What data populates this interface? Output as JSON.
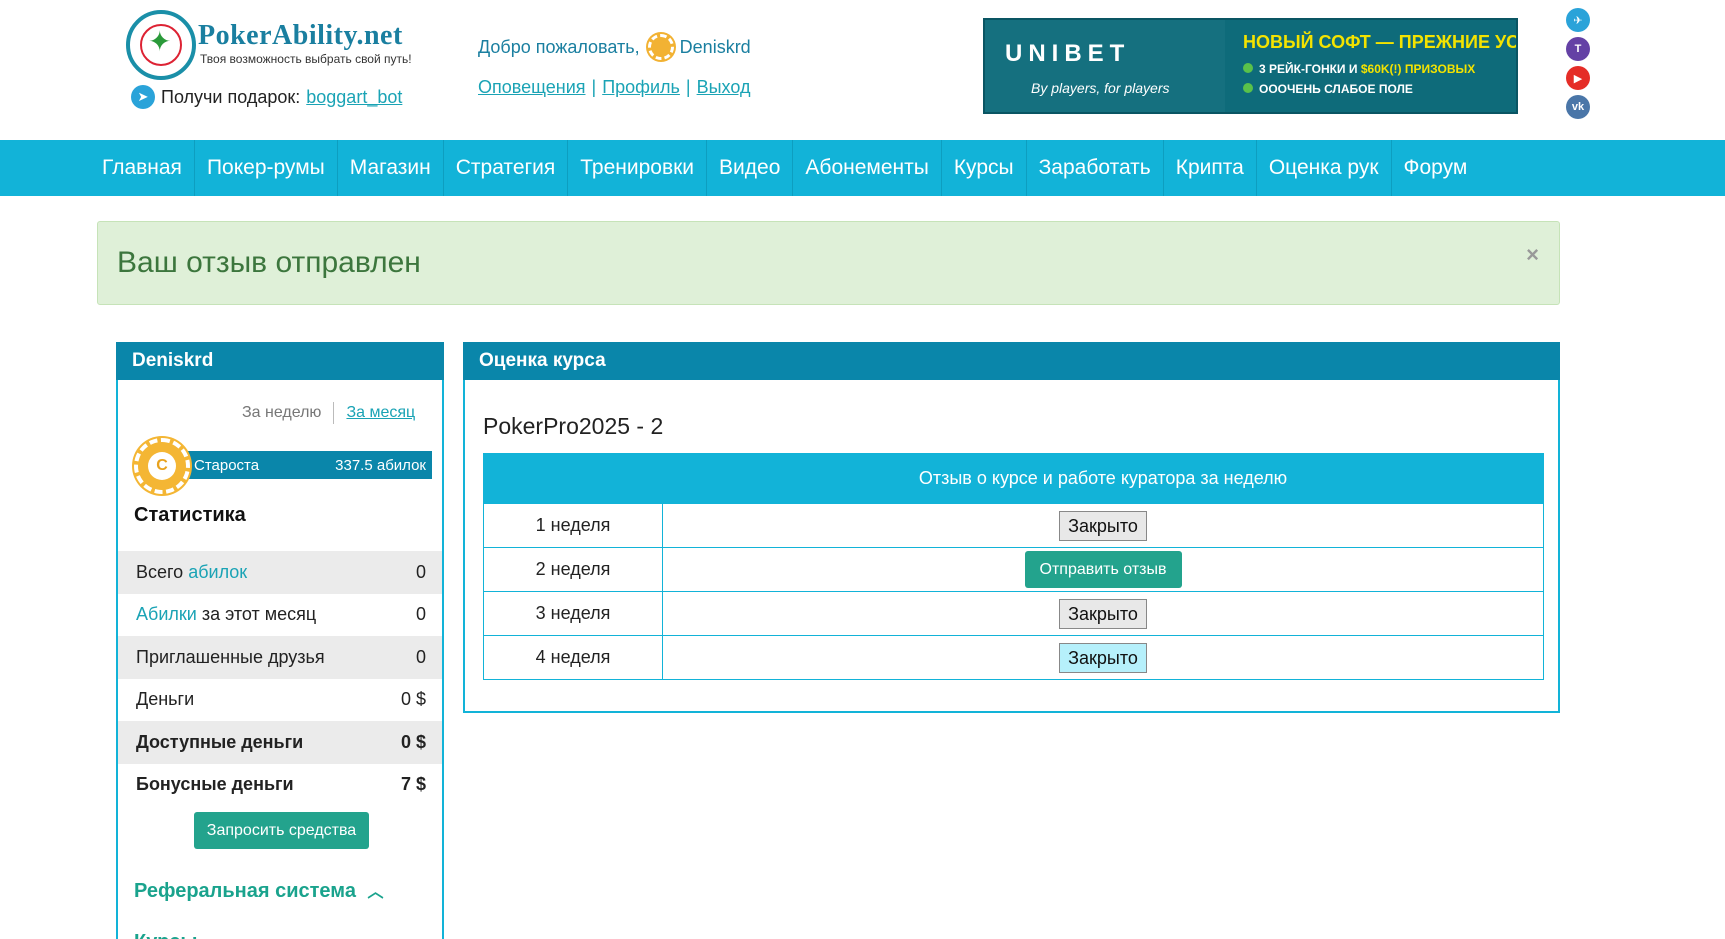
{
  "header": {
    "logo_title": "PokerAbility.net",
    "logo_subtitle": "Твоя возможность выбрать свой путь!",
    "gift_label": "Получи подарок:",
    "gift_bot": "boggart_bot",
    "welcome_text": "Добро пожаловать,",
    "username": "Deniskrd",
    "links": [
      "Оповещения",
      "Профиль",
      "Выход"
    ]
  },
  "banner": {
    "brand": "UNIBET",
    "tagline": "By players, for players",
    "headline": "НОВЫЙ СОФТ — ПРЕЖНИЕ УСЛОВИЯ:",
    "line1_a": "3 РЕЙК-ГОНКИ И",
    "line1_b": "$60K(!) ПРИЗОВЫХ",
    "line2": "ОООЧЕНЬ СЛАБОЕ ПОЛЕ"
  },
  "social": {
    "telegram": "telegram-icon",
    "twitch": "twitch-icon",
    "youtube": "youtube-icon",
    "vk": "vk-icon",
    "labels": [
      "✈",
      "T",
      "▶",
      "vk"
    ]
  },
  "nav": [
    "Главная",
    "Покер-румы",
    "Магазин",
    "Стратегия",
    "Тренировки",
    "Видео",
    "Абонементы",
    "Курсы",
    "Заработать",
    "Крипта",
    "Оценка рук",
    "Форум"
  ],
  "alert": {
    "message": "Ваш отзыв отправлен",
    "close": "×"
  },
  "sidebar": {
    "title": "Deniskrd",
    "period_week": "За неделю",
    "period_month": "За месяц",
    "chip_letter": "C",
    "rank_label": "Староста",
    "rank_value": "337.5 абилок",
    "stats_title": "Статистика",
    "stats": [
      {
        "pre": "Всего ",
        "hl": "абилок",
        "post": "",
        "value": "0"
      },
      {
        "pre": "",
        "hl": "Абилки",
        "post": " за этот месяц",
        "value": "0"
      },
      {
        "pre": "Приглашенные друзья",
        "hl": "",
        "post": "",
        "value": "0"
      },
      {
        "pre": "Деньги",
        "hl": "",
        "post": "",
        "value": "0 $"
      },
      {
        "pre": "Доступные деньги",
        "hl": "",
        "post": "",
        "value": "0 $"
      },
      {
        "pre": "Бонусные деньги",
        "hl": "",
        "post": "",
        "value": "7 $"
      }
    ],
    "request_button": "Запросить средства",
    "referral": "Реферальная система",
    "referral_icon": "chevron-up-icon",
    "next_section": "Курсы"
  },
  "panel": {
    "title": "Оценка курса",
    "course_name": "PokerPro2025 - 2",
    "column_header": "Отзыв о курсе и работе куратора за неделю",
    "weeks": [
      {
        "label": "1 неделя",
        "button": "Закрыто",
        "style": "gray"
      },
      {
        "label": "2 неделя",
        "button": "Отправить отзыв",
        "style": "green"
      },
      {
        "label": "3 неделя",
        "button": "Закрыто",
        "style": "gray"
      },
      {
        "label": "4 неделя",
        "button": "Закрыто",
        "style": "cyan"
      }
    ]
  },
  "colors": {
    "nav_bg": "#12b3d8",
    "panel_header": "#0a86aa",
    "accent_green": "#23a38d",
    "alert_bg": "#dff0d8",
    "alert_text": "#3c763d"
  }
}
